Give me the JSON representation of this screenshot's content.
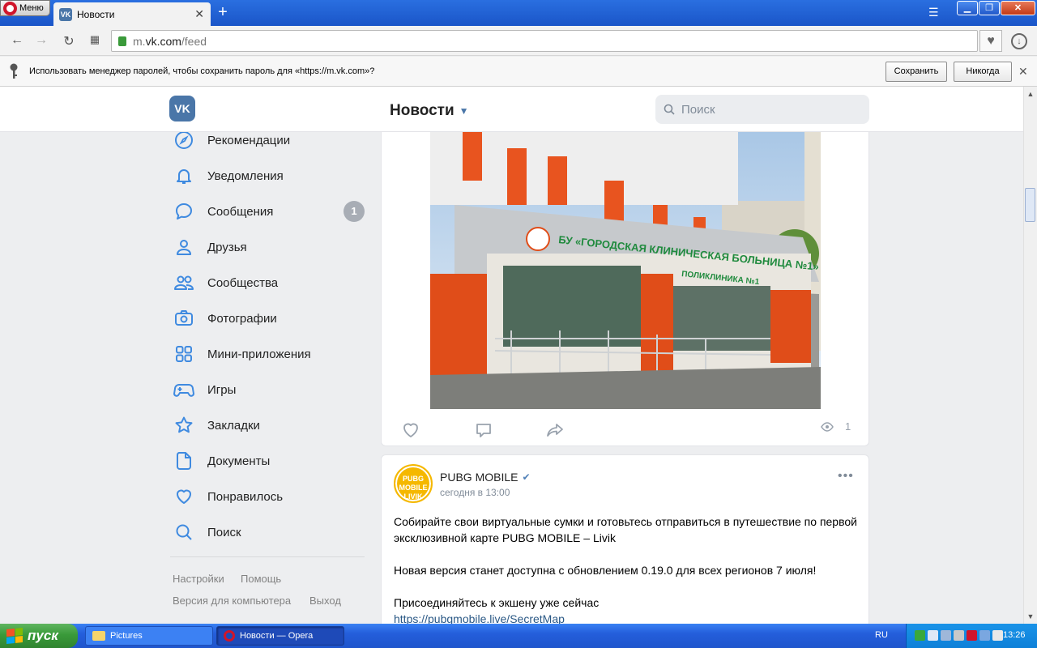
{
  "browser": {
    "menu_label": "Меню",
    "tab_title": "Новости",
    "tab_favicon": "VK",
    "url_host": "m.",
    "url_domain": "vk.com",
    "url_path": "/feed",
    "password_bar": {
      "message": "Использовать менеджер паролей, чтобы сохранить пароль для «https://m.vk.com»?",
      "save_label": "Сохранить",
      "never_label": "Никогда"
    }
  },
  "vk": {
    "logo": "VK",
    "page_title": "Новости",
    "search_placeholder": "Поиск",
    "sidebar": [
      {
        "label": "Рекомендации",
        "icon": "compass-icon"
      },
      {
        "label": "Уведомления",
        "icon": "bell-icon"
      },
      {
        "label": "Сообщения",
        "icon": "message-icon",
        "badge": "1"
      },
      {
        "label": "Друзья",
        "icon": "user-icon"
      },
      {
        "label": "Сообщества",
        "icon": "users-icon"
      },
      {
        "label": "Фотографии",
        "icon": "camera-icon"
      },
      {
        "label": "Мини-приложения",
        "icon": "grid-icon"
      },
      {
        "label": "Игры",
        "icon": "gamepad-icon"
      },
      {
        "label": "Закладки",
        "icon": "star-icon"
      },
      {
        "label": "Документы",
        "icon": "document-icon"
      },
      {
        "label": "Понравилось",
        "icon": "heart-icon"
      },
      {
        "label": "Поиск",
        "icon": "search-icon"
      }
    ],
    "footer_links": {
      "settings": "Настройки",
      "help": "Помощь",
      "desktop": "Версия для компьютера",
      "logout": "Выход"
    },
    "post1": {
      "photo_sign": "БУ «ГОРОДСКАЯ КЛИНИЧЕСКАЯ БОЛЬНИЦА №1»",
      "photo_sign2": "ПОЛИКЛИНИКА №1",
      "views": "1"
    },
    "post2": {
      "author": "PUBG MOBILE",
      "avatar_text": "PUBG MOBILE LIVIK",
      "time": "сегодня в 13:00",
      "text1": "Собирайте свои виртуальные сумки и готовьтесь отправиться в путешествие по первой эксклюзивной карте PUBG MOBILE – Livik",
      "text2": "Новая версия станет доступна с обновлением 0.19.0 для всех регионов 7 июля!",
      "text3": "Присоединяйтесь к экшену уже сейчас",
      "link": "https://pubgmobile.live/SecretMap"
    },
    "colors": {
      "accent": "#4a76a8",
      "page_bg": "#edeef0",
      "link": "#2a5885",
      "icon": "#3f8ae0"
    }
  },
  "taskbar": {
    "start_label": "пуск",
    "tasks": [
      {
        "label": "Pictures",
        "icon": "folder-icon"
      },
      {
        "label": "Новости — Opera",
        "icon": "opera-icon"
      }
    ],
    "language": "RU",
    "clock": "13:26"
  }
}
